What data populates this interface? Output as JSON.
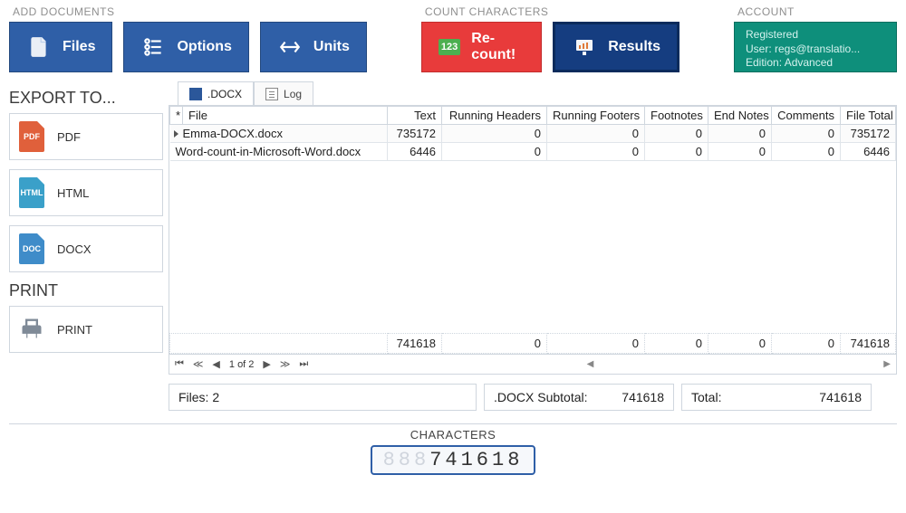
{
  "ribbon": {
    "groups": {
      "add_docs": {
        "title": "ADD DOCUMENTS",
        "files": "Files",
        "options": "Options",
        "units": "Units"
      },
      "count": {
        "title": "COUNT CHARACTERS",
        "recount": "Re-count!",
        "results": "Results"
      },
      "account": {
        "title": "ACCOUNT",
        "status": "Registered",
        "user": "User: regs@translatio...",
        "edition": "Edition: Advanced"
      }
    }
  },
  "sidebar": {
    "export_title": "EXPORT TO...",
    "pdf": "PDF",
    "html": "HTML",
    "docx": "DOCX",
    "print_title": "PRINT",
    "print": "PRINT"
  },
  "tabs": {
    "docx": ".DOCX",
    "log": "Log"
  },
  "grid": {
    "headers": {
      "file": "File",
      "text": "Text",
      "rh": "Running Headers",
      "rf": "Running Footers",
      "footnotes": "Footnotes",
      "endnotes": "End Notes",
      "comments": "Comments",
      "total": "File Total"
    },
    "rows": [
      {
        "file": "Emma-DOCX.docx",
        "text": "735172",
        "rh": "0",
        "rf": "0",
        "footnotes": "0",
        "endnotes": "0",
        "comments": "0",
        "total": "735172"
      },
      {
        "file": "Word-count-in-Microsoft-Word.docx",
        "text": "6446",
        "rh": "0",
        "rf": "0",
        "footnotes": "0",
        "endnotes": "0",
        "comments": "0",
        "total": "6446"
      }
    ],
    "footer": {
      "text": "741618",
      "rh": "0",
      "rf": "0",
      "footnotes": "0",
      "endnotes": "0",
      "comments": "0",
      "total": "741618"
    },
    "pager": "1 of 2"
  },
  "summary": {
    "files_label": "Files:",
    "files_value": "2",
    "subtotal_label": ".DOCX Subtotal:",
    "subtotal_value": "741618",
    "total_label": "Total:",
    "total_value": "741618"
  },
  "characters": {
    "label": "CHARACTERS",
    "pad": "888",
    "value": "741618"
  }
}
